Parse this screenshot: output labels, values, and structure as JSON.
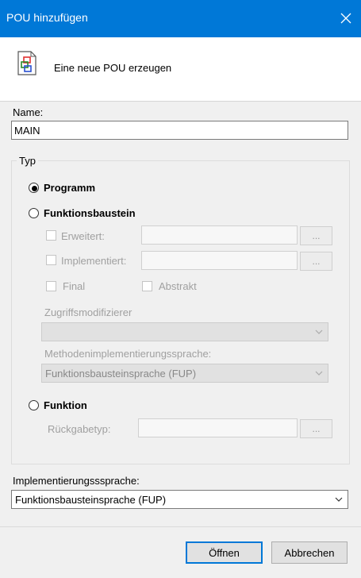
{
  "window": {
    "title": "POU hinzufügen"
  },
  "header": {
    "text": "Eine neue POU erzeugen",
    "icon": "pou-document-icon"
  },
  "name_field": {
    "label": "Name:",
    "value": "MAIN"
  },
  "typ": {
    "legend": "Typ",
    "programm": {
      "label": "Programm",
      "selected": true
    },
    "funktionsbaustein": {
      "label": "Funktionsbaustein",
      "selected": false,
      "erweitert": "Erweitert:",
      "implementiert": "Implementiert:",
      "browse": "...",
      "final": "Final",
      "abstrakt": "Abstrakt",
      "zugriff_label": "Zugriffsmodifizierer",
      "zugriff_value": "",
      "methoden_label": "Methodenimplementierungssprache:",
      "methoden_value": "Funktionsbausteinsprache (FUP)"
    },
    "funktion": {
      "label": "Funktion",
      "selected": false,
      "rueckgabe_label": "Rückgabetyp:",
      "browse": "..."
    }
  },
  "impl": {
    "label": "Implementierungsssprache:",
    "value": "Funktionsbausteinsprache (FUP)"
  },
  "buttons": {
    "open": "Öffnen",
    "cancel": "Abbrechen"
  },
  "colors": {
    "titlebar": "#0078d7",
    "accent": "#0078d7"
  }
}
